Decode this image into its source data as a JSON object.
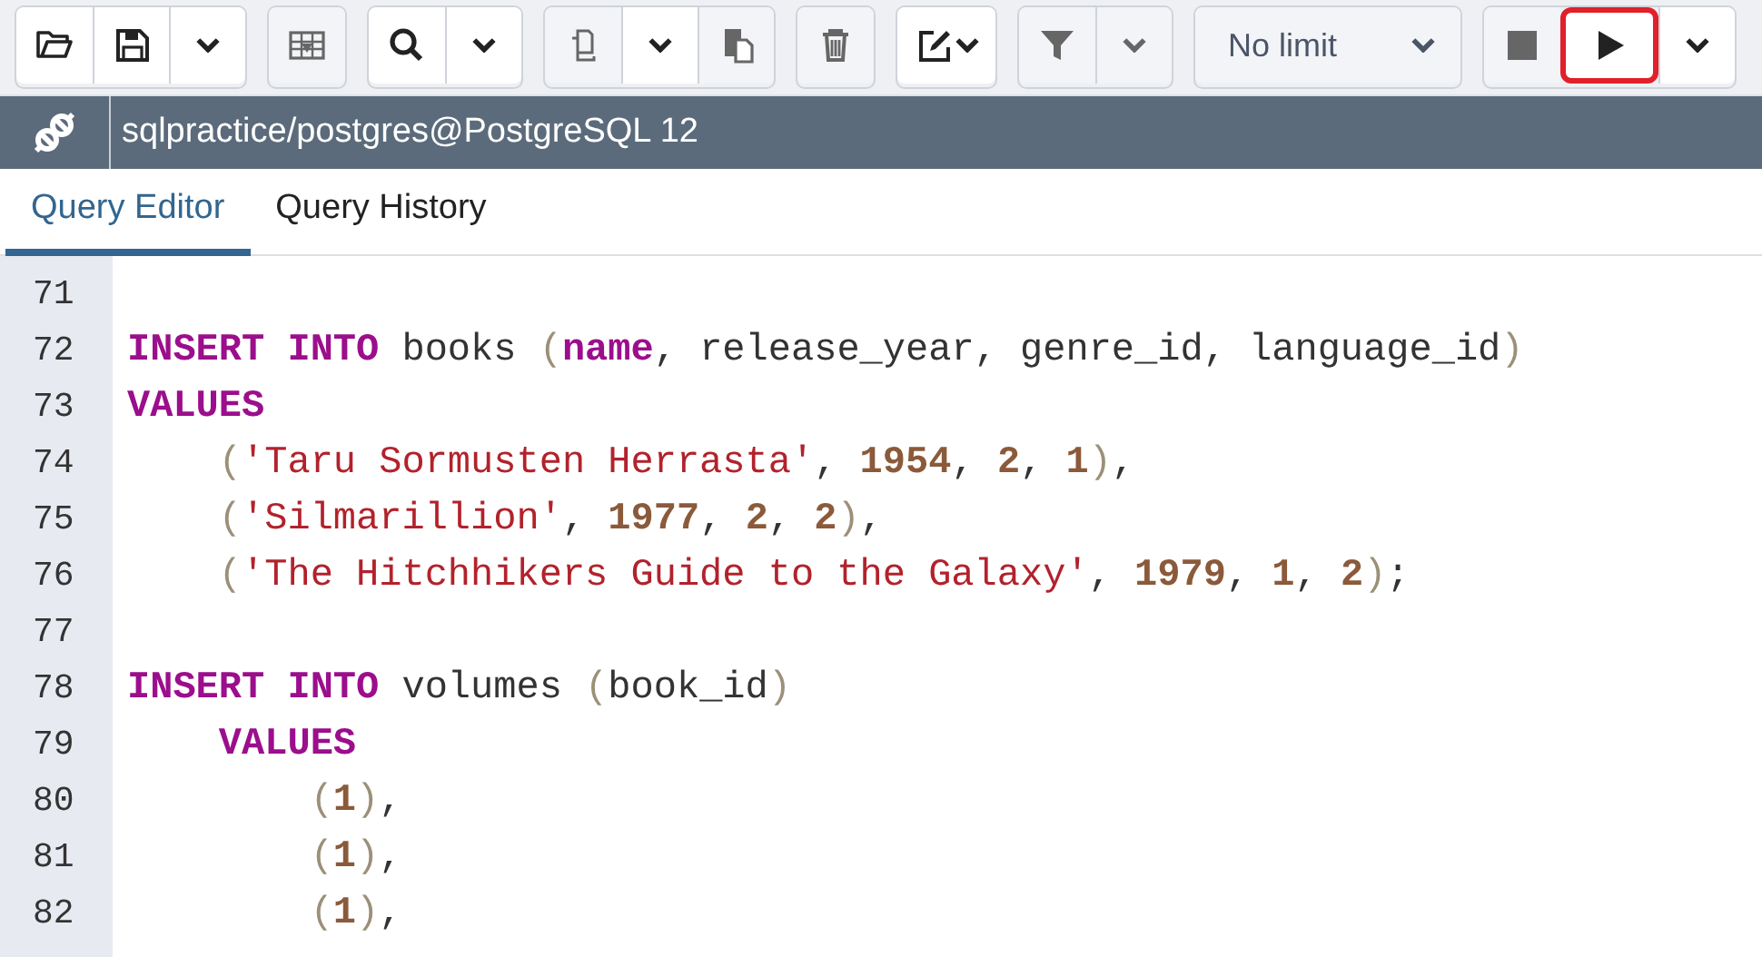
{
  "toolbar": {
    "groups": [
      {
        "buttons": [
          {
            "kind": "open",
            "disabled": false,
            "highlighted": false
          },
          {
            "kind": "save",
            "disabled": false,
            "highlighted": false
          },
          {
            "kind": "caret",
            "disabled": false,
            "highlighted": false
          }
        ]
      },
      {
        "buttons": [
          {
            "kind": "download",
            "disabled": true,
            "highlighted": false
          }
        ]
      },
      {
        "buttons": [
          {
            "kind": "search",
            "disabled": false,
            "highlighted": false
          },
          {
            "kind": "caret",
            "disabled": false,
            "highlighted": false
          }
        ]
      },
      {
        "buttons": [
          {
            "kind": "copy",
            "disabled": true,
            "highlighted": false
          },
          {
            "kind": "caret",
            "disabled": false,
            "highlighted": false
          },
          {
            "kind": "paste",
            "disabled": true,
            "highlighted": false
          }
        ]
      },
      {
        "buttons": [
          {
            "kind": "delete",
            "disabled": true,
            "highlighted": false
          }
        ]
      },
      {
        "buttons": [
          {
            "kind": "edit",
            "disabled": false,
            "highlighted": false
          }
        ]
      },
      {
        "buttons": [
          {
            "kind": "filter",
            "disabled": true,
            "highlighted": false
          },
          {
            "kind": "caret",
            "disabled": true,
            "highlighted": false
          }
        ]
      },
      {
        "buttons": [
          {
            "kind": "limit",
            "label": "No limit",
            "disabled": true,
            "highlighted": false
          }
        ]
      },
      {
        "buttons": [
          {
            "kind": "stop",
            "disabled": true,
            "highlighted": false
          },
          {
            "kind": "execute",
            "disabled": false,
            "highlighted": true
          },
          {
            "kind": "caret",
            "disabled": false,
            "highlighted": false
          }
        ]
      }
    ]
  },
  "connection": {
    "title": "sqlpractice/postgres@PostgreSQL 12"
  },
  "tabs": [
    {
      "label": "Query Editor",
      "selected": true
    },
    {
      "label": "Query History",
      "selected": false
    }
  ],
  "editor": {
    "lines": [
      {
        "number": "71"
      },
      {
        "number": "72",
        "tokens": [
          {
            "kind": "keyword",
            "text": "INSERT INTO"
          },
          {
            "kind": "plain",
            "text": " books "
          },
          {
            "kind": "paren",
            "text": "("
          },
          {
            "kind": "keyword",
            "text": "name"
          },
          {
            "kind": "plain",
            "text": ", release_year, genre_id, language_id"
          },
          {
            "kind": "paren",
            "text": ")"
          }
        ]
      },
      {
        "number": "73",
        "tokens": [
          {
            "kind": "keyword",
            "text": "VALUES"
          }
        ]
      },
      {
        "number": "74",
        "tokens": [
          {
            "kind": "paren",
            "text": "    ("
          },
          {
            "kind": "string",
            "text": "'Taru Sormusten Herrasta'"
          },
          {
            "kind": "plain",
            "text": ", "
          },
          {
            "kind": "number",
            "text": "1954"
          },
          {
            "kind": "plain",
            "text": ", "
          },
          {
            "kind": "number",
            "text": "2"
          },
          {
            "kind": "plain",
            "text": ", "
          },
          {
            "kind": "number",
            "text": "1"
          },
          {
            "kind": "paren",
            "text": ")"
          },
          {
            "kind": "plain",
            "text": ","
          }
        ]
      },
      {
        "number": "75",
        "tokens": [
          {
            "kind": "paren",
            "text": "    ("
          },
          {
            "kind": "string",
            "text": "'Silmarillion'"
          },
          {
            "kind": "plain",
            "text": ", "
          },
          {
            "kind": "number",
            "text": "1977"
          },
          {
            "kind": "plain",
            "text": ", "
          },
          {
            "kind": "number",
            "text": "2"
          },
          {
            "kind": "plain",
            "text": ", "
          },
          {
            "kind": "number",
            "text": "2"
          },
          {
            "kind": "paren",
            "text": ")"
          },
          {
            "kind": "plain",
            "text": ","
          }
        ]
      },
      {
        "number": "76",
        "tokens": [
          {
            "kind": "paren",
            "text": "    ("
          },
          {
            "kind": "string",
            "text": "'The Hitchhikers Guide to the Galaxy'"
          },
          {
            "kind": "plain",
            "text": ", "
          },
          {
            "kind": "number",
            "text": "1979"
          },
          {
            "kind": "plain",
            "text": ", "
          },
          {
            "kind": "number",
            "text": "1"
          },
          {
            "kind": "plain",
            "text": ", "
          },
          {
            "kind": "number",
            "text": "2"
          },
          {
            "kind": "paren",
            "text": ")"
          },
          {
            "kind": "plain",
            "text": ";"
          }
        ]
      },
      {
        "number": "77"
      },
      {
        "number": "78",
        "tokens": [
          {
            "kind": "keyword",
            "text": "INSERT INTO"
          },
          {
            "kind": "plain",
            "text": " volumes "
          },
          {
            "kind": "paren",
            "text": "("
          },
          {
            "kind": "plain",
            "text": "book_id"
          },
          {
            "kind": "paren",
            "text": ")"
          }
        ]
      },
      {
        "number": "79",
        "tokens": [
          {
            "kind": "keyword",
            "text": "    VALUES"
          }
        ]
      },
      {
        "number": "80",
        "tokens": [
          {
            "kind": "paren",
            "text": "        ("
          },
          {
            "kind": "number",
            "text": "1"
          },
          {
            "kind": "paren",
            "text": ")"
          },
          {
            "kind": "plain",
            "text": ","
          }
        ]
      },
      {
        "number": "81",
        "tokens": [
          {
            "kind": "paren",
            "text": "        ("
          },
          {
            "kind": "number",
            "text": "1"
          },
          {
            "kind": "paren",
            "text": ")"
          },
          {
            "kind": "plain",
            "text": ","
          }
        ]
      },
      {
        "number": "82",
        "tokens": [
          {
            "kind": "paren",
            "text": "        ("
          },
          {
            "kind": "number",
            "text": "1"
          },
          {
            "kind": "paren",
            "text": ")"
          },
          {
            "kind": "plain",
            "text": ","
          }
        ]
      }
    ]
  }
}
